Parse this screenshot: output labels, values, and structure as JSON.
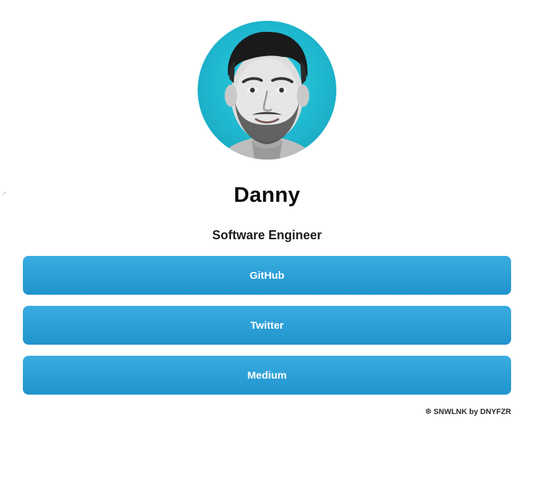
{
  "profile": {
    "name": "Danny",
    "title": "Software Engineer",
    "avatar_icon": "portrait-photo"
  },
  "links": [
    {
      "label": "GitHub"
    },
    {
      "label": "Twitter"
    },
    {
      "label": "Medium"
    }
  ],
  "footer": {
    "icon": "❆",
    "brand": "SNWLNK by DNYFZR"
  },
  "colors": {
    "button": "#2b9fd6",
    "avatar_bg": "#1fb7cf",
    "text": "#0d0d0d"
  },
  "misc": {
    "edge_glyph": "↗"
  }
}
